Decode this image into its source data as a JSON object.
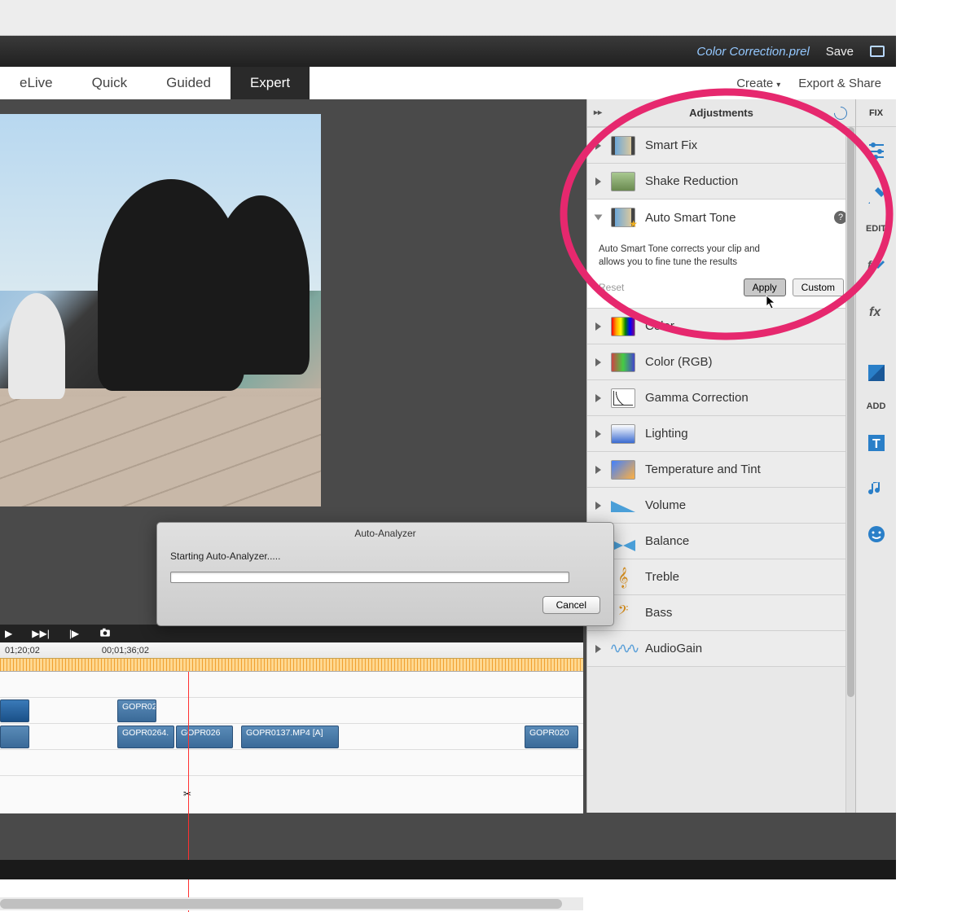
{
  "titlebar": {
    "project_name": "Color Correction.prel",
    "save": "Save"
  },
  "modes": {
    "elive": "eLive",
    "quick": "Quick",
    "guided": "Guided",
    "expert": "Expert",
    "create": "Create",
    "export": "Export & Share"
  },
  "panel": {
    "title": "Adjustments",
    "items": {
      "smartfix": "Smart Fix",
      "shake": "Shake Reduction",
      "autosmart": "Auto Smart Tone",
      "color": "Color",
      "colorrgb": "Color (RGB)",
      "gamma": "Gamma Correction",
      "lighting": "Lighting",
      "temp": "Temperature and Tint",
      "volume": "Volume",
      "balance": "Balance",
      "treble": "Treble",
      "bass": "Bass",
      "gain": "AudioGain"
    },
    "autosmart_desc": "Auto Smart Tone corrects your clip and allows you to fine tune the results",
    "reset": "Reset",
    "apply": "Apply",
    "custom": "Custom"
  },
  "rail": {
    "fix": "FIX",
    "edit": "EDIT",
    "add": "ADD"
  },
  "timecodes": {
    "t1": "01;20;02",
    "t2": "00;01;36;02"
  },
  "clips": {
    "c1": "GOPR02",
    "c2": "GOPR0264.",
    "c3": "GOPR026",
    "c4": "GOPR0137.MP4 [A]",
    "c5": "GOPR020"
  },
  "dialog": {
    "title": "Auto-Analyzer",
    "message": "Starting Auto-Analyzer.....",
    "cancel": "Cancel"
  }
}
